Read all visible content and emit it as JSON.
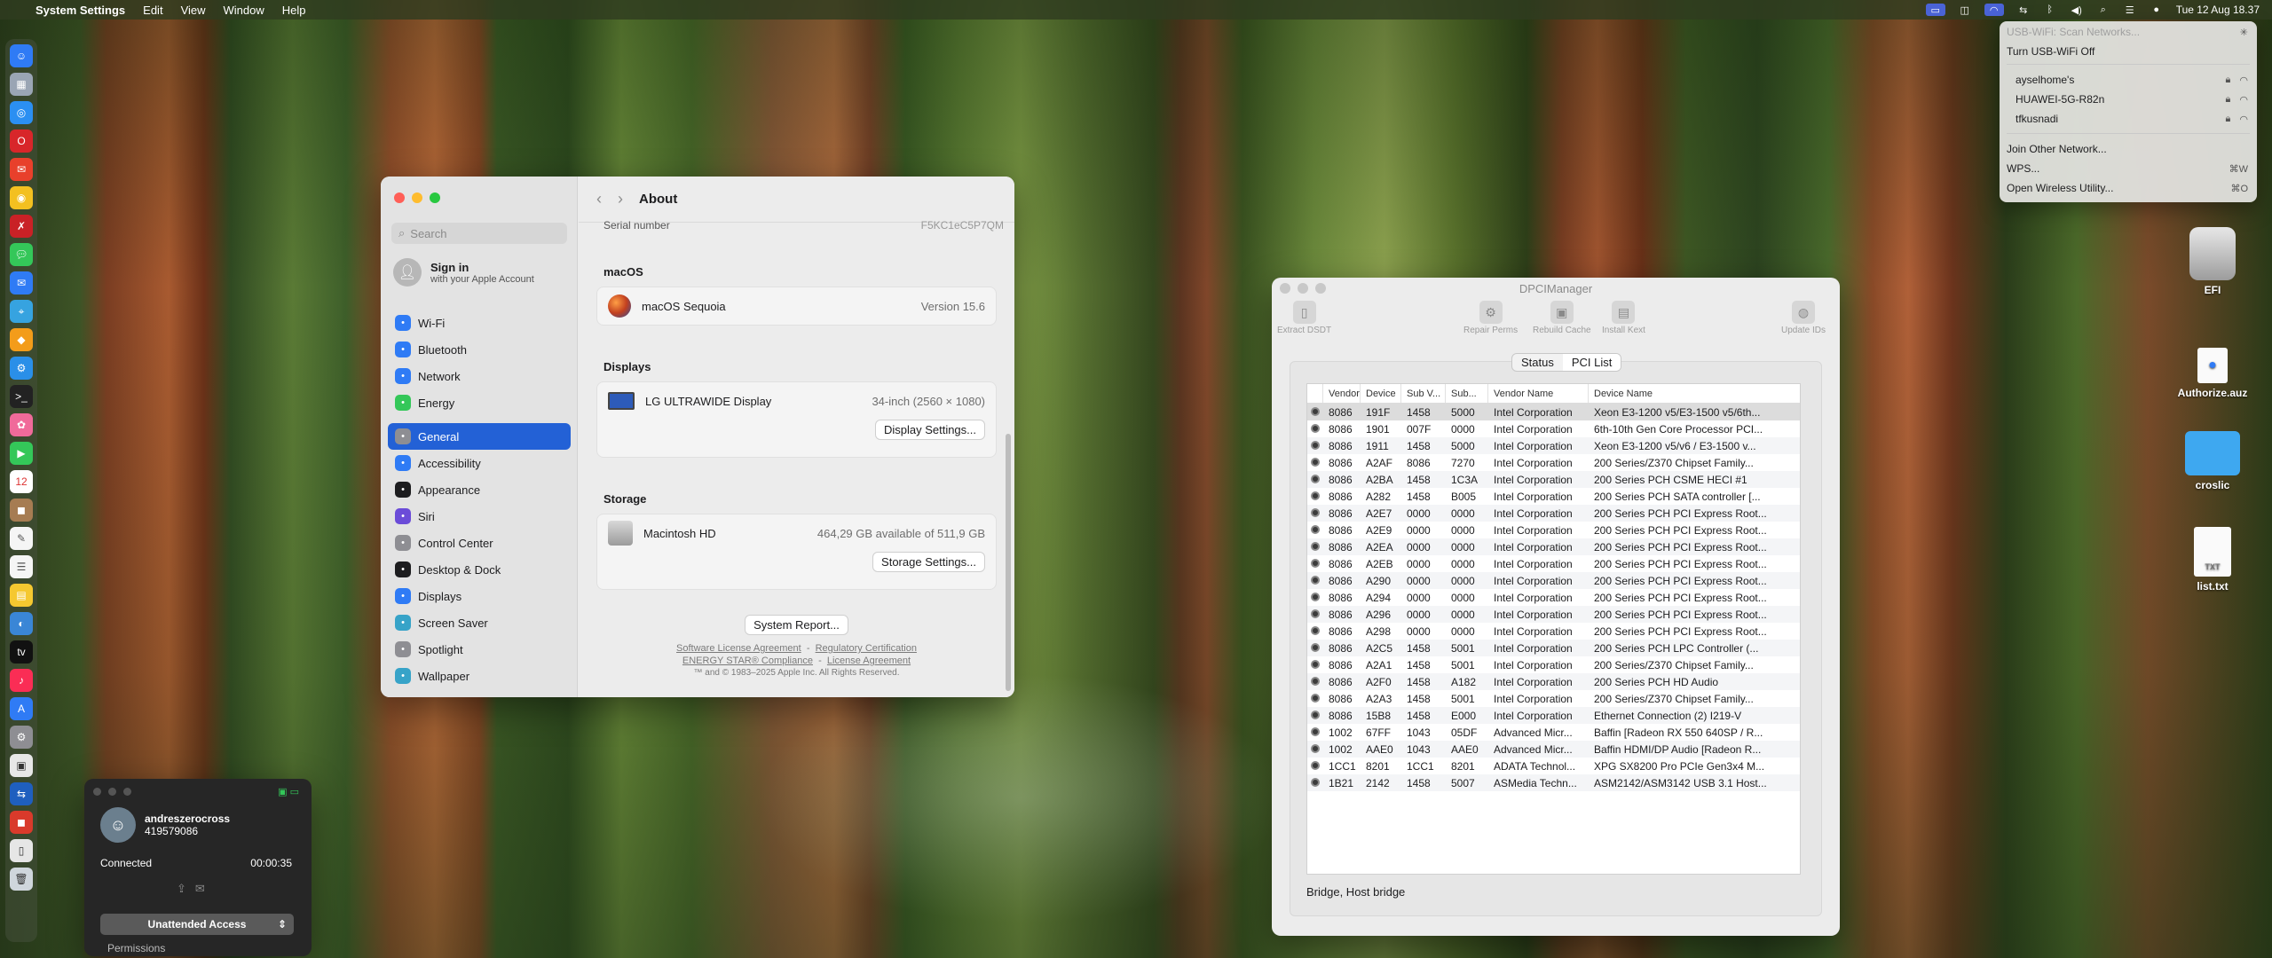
{
  "menubar": {
    "app_name": "System Settings",
    "menus": [
      "Edit",
      "View",
      "Window",
      "Help"
    ],
    "clock": "Tue 12 Aug  18.37"
  },
  "wifi_menu": {
    "header": "USB-WiFi: Scan Networks...",
    "toggle": "Turn USB-WiFi Off",
    "networks": [
      "ayselhome's",
      "HUAWEI-5G-R82n",
      "tfkusnadi"
    ],
    "join_other": "Join Other Network...",
    "wps": "WPS...",
    "wps_shortcut": "⌘W",
    "wireless_utility": "Open Wireless Utility...",
    "wireless_shortcut": "⌘O"
  },
  "settings": {
    "search_placeholder": "Search",
    "account_title": "Sign in",
    "account_subtitle": "with your Apple Account",
    "nav": [
      {
        "label": "Wi-Fi",
        "icon": "wifi-icon",
        "color": "#2f7bf5"
      },
      {
        "label": "Bluetooth",
        "icon": "bluetooth-icon",
        "color": "#2f7bf5"
      },
      {
        "label": "Network",
        "icon": "globe-icon",
        "color": "#2f7bf5"
      },
      {
        "label": "Energy",
        "icon": "battery-icon",
        "color": "#34c759"
      },
      {
        "label": "General",
        "icon": "gear-icon",
        "color": "#8e8e93"
      },
      {
        "label": "Accessibility",
        "icon": "accessibility-icon",
        "color": "#2f7bf5"
      },
      {
        "label": "Appearance",
        "icon": "appearance-icon",
        "color": "#1d1d1f"
      },
      {
        "label": "Siri",
        "icon": "siri-icon",
        "color": "#6b4cd8"
      },
      {
        "label": "Control Center",
        "icon": "control-center-icon",
        "color": "#8e8e93"
      },
      {
        "label": "Desktop & Dock",
        "icon": "dock-icon",
        "color": "#1d1d1f"
      },
      {
        "label": "Displays",
        "icon": "display-icon",
        "color": "#2f7bf5"
      },
      {
        "label": "Screen Saver",
        "icon": "screensaver-icon",
        "color": "#37a3c8"
      },
      {
        "label": "Spotlight",
        "icon": "spotlight-icon",
        "color": "#8e8e93"
      },
      {
        "label": "Wallpaper",
        "icon": "wallpaper-icon",
        "color": "#37a3c8"
      }
    ],
    "page_title": "About",
    "serial_label": "Serial number",
    "serial_value": "F5KC1eC5P7QM",
    "macos_header": "macOS",
    "macos_name": "macOS Sequoia",
    "macos_version": "Version 15.6",
    "displays_header": "Displays",
    "display_name": "LG ULTRAWIDE Display",
    "display_value": "34-inch (2560 × 1080)",
    "display_settings_btn": "Display Settings...",
    "storage_header": "Storage",
    "disk_name": "Macintosh HD",
    "disk_value": "464,29 GB available of 511,9 GB",
    "storage_settings_btn": "Storage Settings...",
    "system_report_btn": "System Report...",
    "legal_1a": "Software License Agreement",
    "legal_1b": "Regulatory Certification",
    "legal_2a": "ENERGY STAR® Compliance",
    "legal_2b": "License Agreement",
    "legal_3": "™ and © 1983–2025 Apple Inc. All Rights Reserved.",
    "sep": "-"
  },
  "dpci": {
    "title": "DPCIManager",
    "toolbar": [
      "Extract DSDT",
      "Repair Perms",
      "Rebuild Cache",
      "Install Kext",
      "Update IDs"
    ],
    "tabs": [
      "Status",
      "PCI List"
    ],
    "columns": [
      "Vendor",
      "Device",
      "Sub V...",
      "Sub...",
      "Vendor Name",
      "Device Name"
    ],
    "rows": [
      [
        "8086",
        "191F",
        "1458",
        "5000",
        "Intel Corporation",
        "Xeon E3-1200 v5/E3-1500 v5/6th..."
      ],
      [
        "8086",
        "1901",
        "007F",
        "0000",
        "Intel Corporation",
        "6th-10th Gen Core Processor PCI..."
      ],
      [
        "8086",
        "1911",
        "1458",
        "5000",
        "Intel Corporation",
        "Xeon E3-1200 v5/v6 / E3-1500 v..."
      ],
      [
        "8086",
        "A2AF",
        "8086",
        "7270",
        "Intel Corporation",
        "200 Series/Z370 Chipset Family..."
      ],
      [
        "8086",
        "A2BA",
        "1458",
        "1C3A",
        "Intel Corporation",
        "200 Series PCH CSME HECI #1"
      ],
      [
        "8086",
        "A282",
        "1458",
        "B005",
        "Intel Corporation",
        "200 Series PCH SATA controller [..."
      ],
      [
        "8086",
        "A2E7",
        "0000",
        "0000",
        "Intel Corporation",
        "200 Series PCH PCI Express Root..."
      ],
      [
        "8086",
        "A2E9",
        "0000",
        "0000",
        "Intel Corporation",
        "200 Series PCH PCI Express Root..."
      ],
      [
        "8086",
        "A2EA",
        "0000",
        "0000",
        "Intel Corporation",
        "200 Series PCH PCI Express Root..."
      ],
      [
        "8086",
        "A2EB",
        "0000",
        "0000",
        "Intel Corporation",
        "200 Series PCH PCI Express Root..."
      ],
      [
        "8086",
        "A290",
        "0000",
        "0000",
        "Intel Corporation",
        "200 Series PCH PCI Express Root..."
      ],
      [
        "8086",
        "A294",
        "0000",
        "0000",
        "Intel Corporation",
        "200 Series PCH PCI Express Root..."
      ],
      [
        "8086",
        "A296",
        "0000",
        "0000",
        "Intel Corporation",
        "200 Series PCH PCI Express Root..."
      ],
      [
        "8086",
        "A298",
        "0000",
        "0000",
        "Intel Corporation",
        "200 Series PCH PCI Express Root..."
      ],
      [
        "8086",
        "A2C5",
        "1458",
        "5001",
        "Intel Corporation",
        "200 Series PCH LPC Controller (..."
      ],
      [
        "8086",
        "A2A1",
        "1458",
        "5001",
        "Intel Corporation",
        "200 Series/Z370 Chipset Family..."
      ],
      [
        "8086",
        "A2F0",
        "1458",
        "A182",
        "Intel Corporation",
        "200 Series PCH HD Audio"
      ],
      [
        "8086",
        "A2A3",
        "1458",
        "5001",
        "Intel Corporation",
        "200 Series/Z370 Chipset Family..."
      ],
      [
        "8086",
        "15B8",
        "1458",
        "E000",
        "Intel Corporation",
        "Ethernet Connection (2) I219-V"
      ],
      [
        "1002",
        "67FF",
        "1043",
        "05DF",
        "Advanced Micr...",
        "Baffin [Radeon RX 550 640SP / R..."
      ],
      [
        "1002",
        "AAE0",
        "1043",
        "AAE0",
        "Advanced Micr...",
        "Baffin HDMI/DP Audio [Radeon R..."
      ],
      [
        "1CC1",
        "8201",
        "1CC1",
        "8201",
        "ADATA Technol...",
        "XPG SX8200 Pro PCIe Gen3x4 M..."
      ],
      [
        "1B21",
        "2142",
        "1458",
        "5007",
        "ASMedia Techn...",
        "ASM2142/ASM3142 USB 3.1 Host..."
      ]
    ],
    "status_text": "Bridge, Host bridge"
  },
  "remote": {
    "name": "andreszerocross",
    "id": "419579086",
    "status": "Connected",
    "timer": "00:00:35",
    "mode": "Unattended Access",
    "permissions": "Permissions"
  },
  "desktop_icons": [
    {
      "label": "EFI",
      "icon": "disk-icon"
    },
    {
      "label": "Authorize.auz",
      "icon": "document-icon"
    },
    {
      "label": "croslic",
      "icon": "folder-icon"
    },
    {
      "label": "list.txt",
      "icon": "text-file-icon"
    }
  ]
}
